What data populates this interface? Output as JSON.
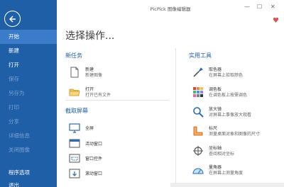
{
  "titlebar": {
    "title": "PicPick 图像编辑器",
    "minimize": "—",
    "maximize": "☐",
    "close": "✕"
  },
  "sidebar": {
    "items": [
      {
        "label": "开始"
      },
      {
        "label": "新建"
      },
      {
        "label": "打开"
      },
      {
        "label": "保存"
      },
      {
        "label": "另存为"
      },
      {
        "label": "打印"
      },
      {
        "label": "分享"
      },
      {
        "label": "详细信息"
      },
      {
        "label": "关闭图像"
      },
      {
        "label": "程序选项"
      },
      {
        "label": "退出"
      }
    ]
  },
  "main": {
    "title": "选择操作...",
    "new_task": {
      "title": "新任务",
      "items": [
        {
          "title": "新建",
          "desc": "新建图像"
        },
        {
          "title": "打开",
          "desc": "打开已有文件"
        }
      ]
    },
    "capture": {
      "title": "截取屏幕",
      "items": [
        {
          "label": "全屏"
        },
        {
          "label": "活动窗口"
        },
        {
          "label": "窗口控件"
        },
        {
          "label": "滚动窗口"
        }
      ]
    },
    "tools": {
      "title": "实用工具",
      "items": [
        {
          "title": "取色器",
          "desc": "在屏幕上拾取颜色"
        },
        {
          "title": "调色板",
          "desc": "在调色板上按需调色"
        },
        {
          "title": "放大镜",
          "desc": "对屏幕上事像放大观看"
        },
        {
          "title": "标尺",
          "desc": "测量桌面对象和图像的尺寸"
        },
        {
          "title": "坐标轴",
          "desc": "查阅相对坐标"
        },
        {
          "title": "量角器",
          "desc": "在屏幕上测量角度"
        }
      ]
    }
  },
  "colors": {
    "sidebar": "#1f5fa8",
    "sidebar_active": "#3b7cc9",
    "accent": "#1f5fa8",
    "heart": "#d9534f"
  }
}
